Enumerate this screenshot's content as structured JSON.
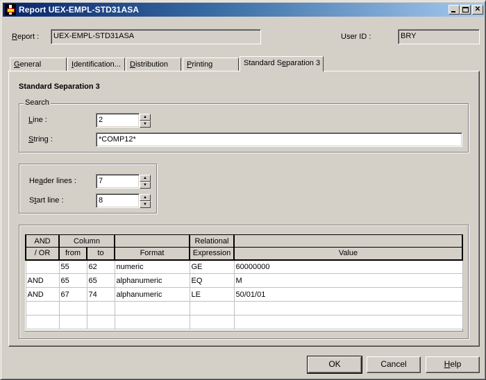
{
  "window": {
    "title": "Report UEX-EMPL-STD31ASA",
    "controls": {
      "minimize": "_",
      "maximize": "□",
      "close": "✕"
    }
  },
  "header": {
    "report_label": "Report :",
    "report_label_underline": "R",
    "report_value": "UEX-EMPL-STD31ASA",
    "userid_label": "User ID :",
    "userid_value": "BRY"
  },
  "tabs": [
    {
      "label": "General",
      "active": false
    },
    {
      "label": "Identification...",
      "active": false
    },
    {
      "label": "Distribution",
      "active": false
    },
    {
      "label": "Printing",
      "active": false
    },
    {
      "label": "Standard Separation 3",
      "active": true
    }
  ],
  "panel": {
    "heading": "Standard Separation 3",
    "search": {
      "legend": "Search",
      "line_label": "Line :",
      "line_value": "2",
      "string_label": "String :",
      "string_value": "*COMP12*"
    },
    "lines": {
      "header_lines_label": "Header lines :",
      "header_lines_value": "7",
      "start_line_label": "Start line :",
      "start_line_value": "8"
    },
    "grid": {
      "header_top": [
        "AND",
        "Column",
        "",
        "Relational",
        ""
      ],
      "header_bottom": [
        "/ OR",
        "from",
        "to",
        "Format",
        "Expression",
        "Value"
      ],
      "rows": [
        [
          "",
          "55",
          "62",
          "numeric",
          "GE",
          "60000000"
        ],
        [
          "AND",
          "65",
          "65",
          "alphanumeric",
          "EQ",
          "M"
        ],
        [
          "AND",
          "67",
          "74",
          "alphanumeric",
          "LE",
          "50/01/01"
        ],
        [
          "",
          "",
          "",
          "",
          "",
          ""
        ],
        [
          "",
          "",
          "",
          "",
          "",
          ""
        ]
      ]
    }
  },
  "buttons": {
    "ok": "OK",
    "cancel": "Cancel",
    "help": "Help"
  },
  "icons": {
    "spin_up": "▲",
    "spin_down": "▼"
  }
}
